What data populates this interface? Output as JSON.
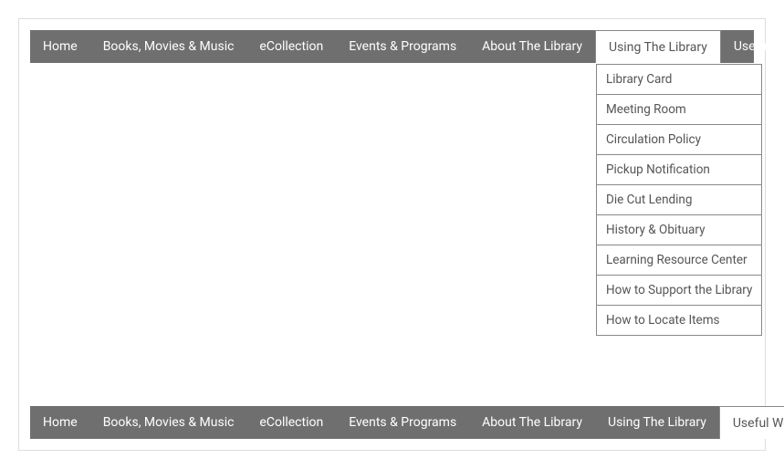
{
  "nav": {
    "items": [
      {
        "label": "Home"
      },
      {
        "label": "Books, Movies & Music"
      },
      {
        "label": "eCollection"
      },
      {
        "label": "Events & Programs"
      },
      {
        "label": "About The Library"
      },
      {
        "label": "Using The Library"
      },
      {
        "label": "Useful Web Resources"
      }
    ]
  },
  "dropdown": {
    "items": [
      {
        "label": "Library Card"
      },
      {
        "label": "Meeting Room"
      },
      {
        "label": "Circulation Policy"
      },
      {
        "label": "Pickup Notification"
      },
      {
        "label": "Die Cut Lending"
      },
      {
        "label": "History & Obituary"
      },
      {
        "label": "Learning Resource Center"
      },
      {
        "label": "How to Support the Library"
      },
      {
        "label": "How to Locate Items"
      }
    ]
  }
}
